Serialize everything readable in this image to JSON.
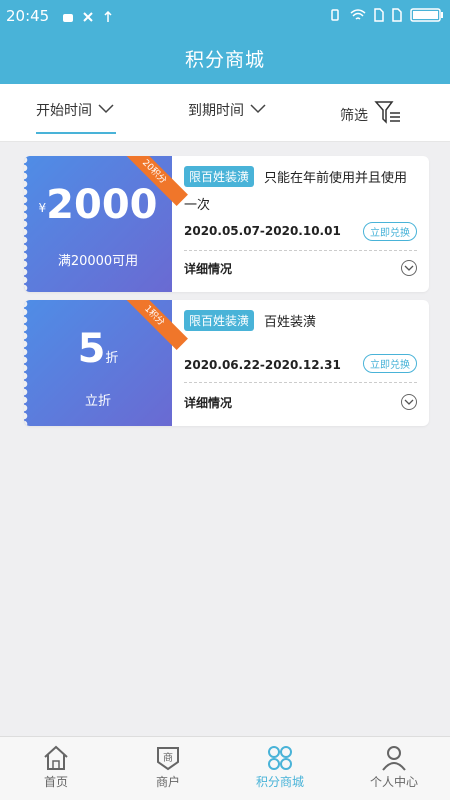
{
  "status": {
    "time": "20:45"
  },
  "header": {
    "title": "积分商城"
  },
  "filters": {
    "start_time": "开始时间",
    "expire_time": "到期时间",
    "screen": "筛选"
  },
  "coupons": [
    {
      "ribbon": "20积分",
      "currency": "¥",
      "value": "2000",
      "condition": "满20000可用",
      "tag": "限百姓装潢",
      "desc_line1": "只能在年前使用并且使用",
      "desc_line2": "一次",
      "date_range": "2020.05.07-2020.10.01",
      "redeem_label": "立即兑换",
      "details_label": "详细情况"
    },
    {
      "ribbon": "1积分",
      "value": "5",
      "unit": "折",
      "condition": "立折",
      "tag": "限百姓装潢",
      "desc_line1": "百姓装潢",
      "date_range": "2020.06.22-2020.12.31",
      "redeem_label": "立即兑换",
      "details_label": "详细情况"
    }
  ],
  "bottom_nav": {
    "items": [
      {
        "label": "首页",
        "icon": "home-icon"
      },
      {
        "label": "商户",
        "icon": "shop-icon"
      },
      {
        "label": "积分商城",
        "icon": "grid-icon",
        "active": true
      },
      {
        "label": "个人中心",
        "icon": "user-icon"
      }
    ]
  },
  "colors": {
    "primary": "#49b3d8",
    "ribbon": "#f0762a",
    "card_gradient_start": "#4f8de6",
    "card_gradient_end": "#6a6ad2"
  }
}
